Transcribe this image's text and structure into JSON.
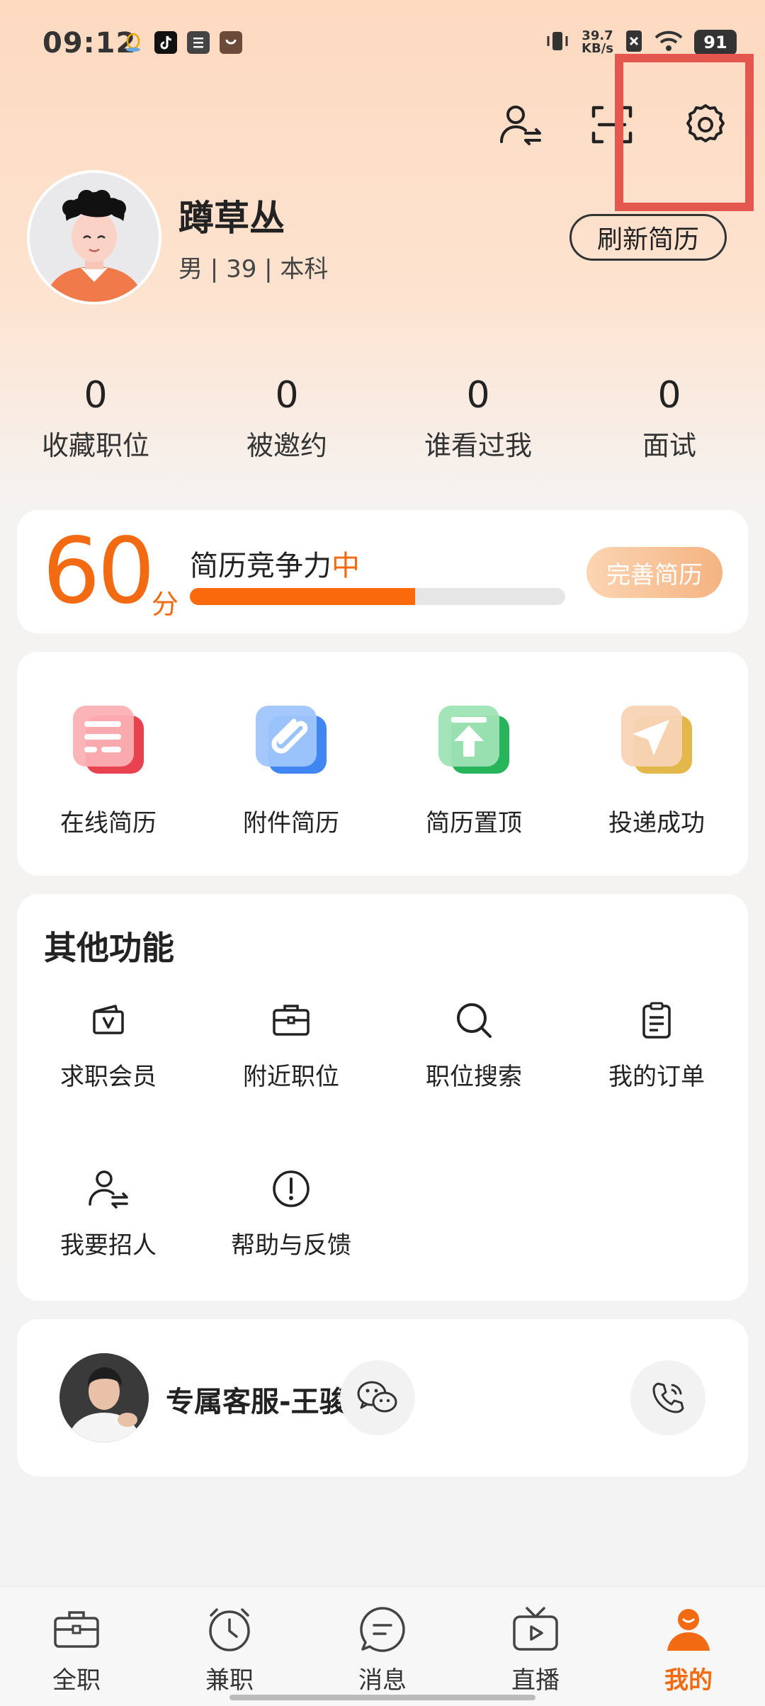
{
  "status_bar": {
    "time": "09:12",
    "net_speed_value": "39.7",
    "net_speed_unit": "KB/s",
    "battery": "91"
  },
  "profile": {
    "name": "蹲草丛",
    "info": "男 | 39 | 本科",
    "refresh_label": "刷新简历"
  },
  "stats": [
    {
      "value": "0",
      "label": "收藏职位"
    },
    {
      "value": "0",
      "label": "被邀约"
    },
    {
      "value": "0",
      "label": "谁看过我"
    },
    {
      "value": "0",
      "label": "面试"
    }
  ],
  "score": {
    "value": "60",
    "unit": "分",
    "label_prefix": "简历竞争力",
    "level": "中",
    "progress_fraction": 0.6,
    "improve_label": "完善简历",
    "accent": "#f26a12"
  },
  "resume_items": [
    {
      "label": "在线简历",
      "icon": "online-resume-icon"
    },
    {
      "label": "附件简历",
      "icon": "attachment-resume-icon"
    },
    {
      "label": "简历置顶",
      "icon": "pin-top-icon"
    },
    {
      "label": "投递成功",
      "icon": "send-success-icon"
    }
  ],
  "other_functions": {
    "title": "其他功能",
    "items": [
      {
        "label": "求职会员",
        "icon": "vip-icon"
      },
      {
        "label": "附近职位",
        "icon": "briefcase-icon"
      },
      {
        "label": "职位搜索",
        "icon": "search-icon"
      },
      {
        "label": "我的订单",
        "icon": "clipboard-icon"
      },
      {
        "label": "我要招人",
        "icon": "recruit-icon"
      },
      {
        "label": "帮助与反馈",
        "icon": "help-icon"
      }
    ]
  },
  "service": {
    "name": "专属客服-王骏"
  },
  "bottom_nav": [
    {
      "label": "全职",
      "icon": "briefcase-icon"
    },
    {
      "label": "兼职",
      "icon": "clock-icon"
    },
    {
      "label": "消息",
      "icon": "message-icon"
    },
    {
      "label": "直播",
      "icon": "tv-icon"
    },
    {
      "label": "我的",
      "icon": "profile-icon",
      "active": true
    }
  ]
}
